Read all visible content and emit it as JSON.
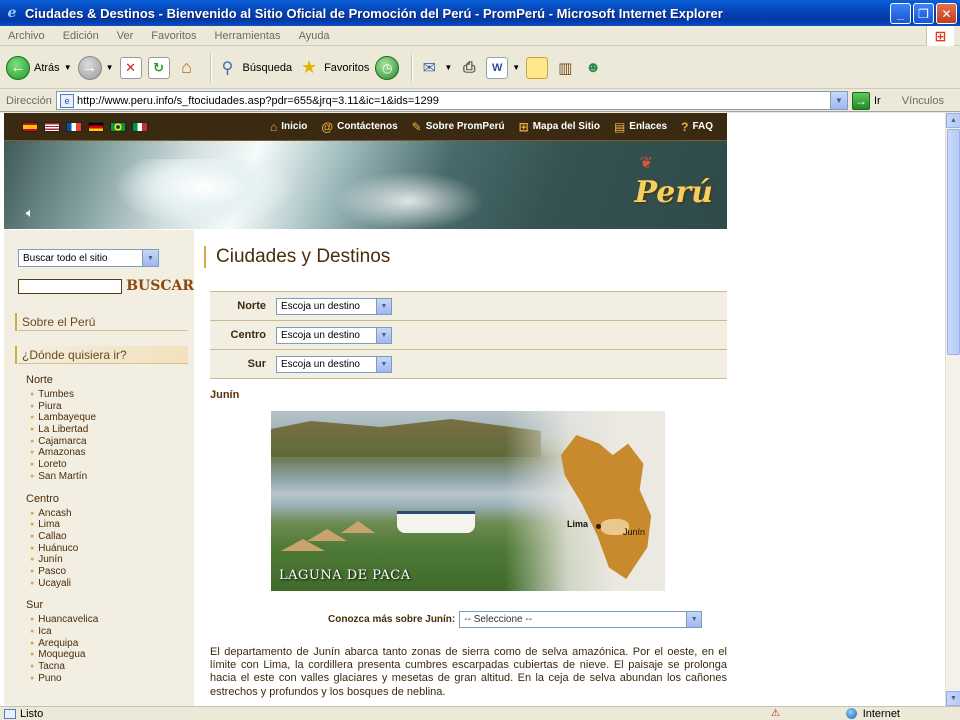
{
  "window": {
    "title": "Ciudades & Destinos - Bienvenido al Sitio Oficial de Promoción del Perú - PromPerú - Microsoft Internet Explorer",
    "minimize": "_",
    "maximize": "❐",
    "close": "✕"
  },
  "menu": [
    "Archivo",
    "Edición",
    "Ver",
    "Favoritos",
    "Herramientas",
    "Ayuda"
  ],
  "toolbar": {
    "back": "Atrás",
    "search": "Búsqueda",
    "favorites": "Favoritos"
  },
  "address": {
    "label": "Dirección",
    "url": "http://www.peru.info/s_ftociudades.asp?pdr=655&jrq=3.11&ic=1&ids=1299",
    "go": "Ir",
    "links": "Vínculos"
  },
  "site": {
    "nav": [
      {
        "icon": "⌂",
        "label": "Inicio"
      },
      {
        "icon": "@",
        "label": "Contáctenos"
      },
      {
        "icon": "✎",
        "label": "Sobre PromPerú"
      },
      {
        "icon": "⊞",
        "label": "Mapa del Sitio"
      },
      {
        "icon": "▤",
        "label": "Enlaces"
      },
      {
        "icon": "?",
        "label": "FAQ"
      }
    ],
    "logo": "Perú",
    "sidebar": {
      "search_scope": "Buscar todo el sitio",
      "search_button": "BUSCAR",
      "about": "Sobre el Perú",
      "where": "¿Dónde quisiera ir?",
      "regions": [
        {
          "name": "Norte",
          "items": [
            "Tumbes",
            "Piura",
            "Lambayeque",
            "La Libertad",
            "Cajamarca",
            "Amazonas",
            "Loreto",
            "San Martín"
          ]
        },
        {
          "name": "Centro",
          "items": [
            "Ancash",
            "Lima",
            "Callao",
            "Huánuco",
            "Junín",
            "Pasco",
            "Ucayali"
          ]
        },
        {
          "name": "Sur",
          "items": [
            "Huancavelica",
            "Ica",
            "Arequipa",
            "Moquegua",
            "Tacna",
            "Puno"
          ]
        }
      ]
    },
    "main": {
      "title": "Ciudades y Destinos",
      "filters": [
        {
          "label": "Norte",
          "value": "Escoja un destino"
        },
        {
          "label": "Centro",
          "value": "Escoja un destino"
        },
        {
          "label": "Sur",
          "value": "Escoja un destino"
        }
      ],
      "section": "Junín",
      "photo": {
        "caption": "LAGUNA DE PACA",
        "map_lima": "Lima",
        "map_junin": "Junín"
      },
      "more_label": "Conozca más sobre Junín:",
      "more_value": "-- Seleccione --",
      "description": "El departamento de Junín abarca tanto zonas de sierra como de selva amazónica. Por el oeste, en el límite con Lima, la cordillera presenta cumbres escarpadas cubiertas de nieve. El paisaje se prolonga hacia el este con valles glaciares y mesetas de gran altitud. En la ceja de selva abundan los cañones estrechos y profundos y los bosques de neblina."
    }
  },
  "status": {
    "text": "Listo",
    "zone": "Internet"
  }
}
